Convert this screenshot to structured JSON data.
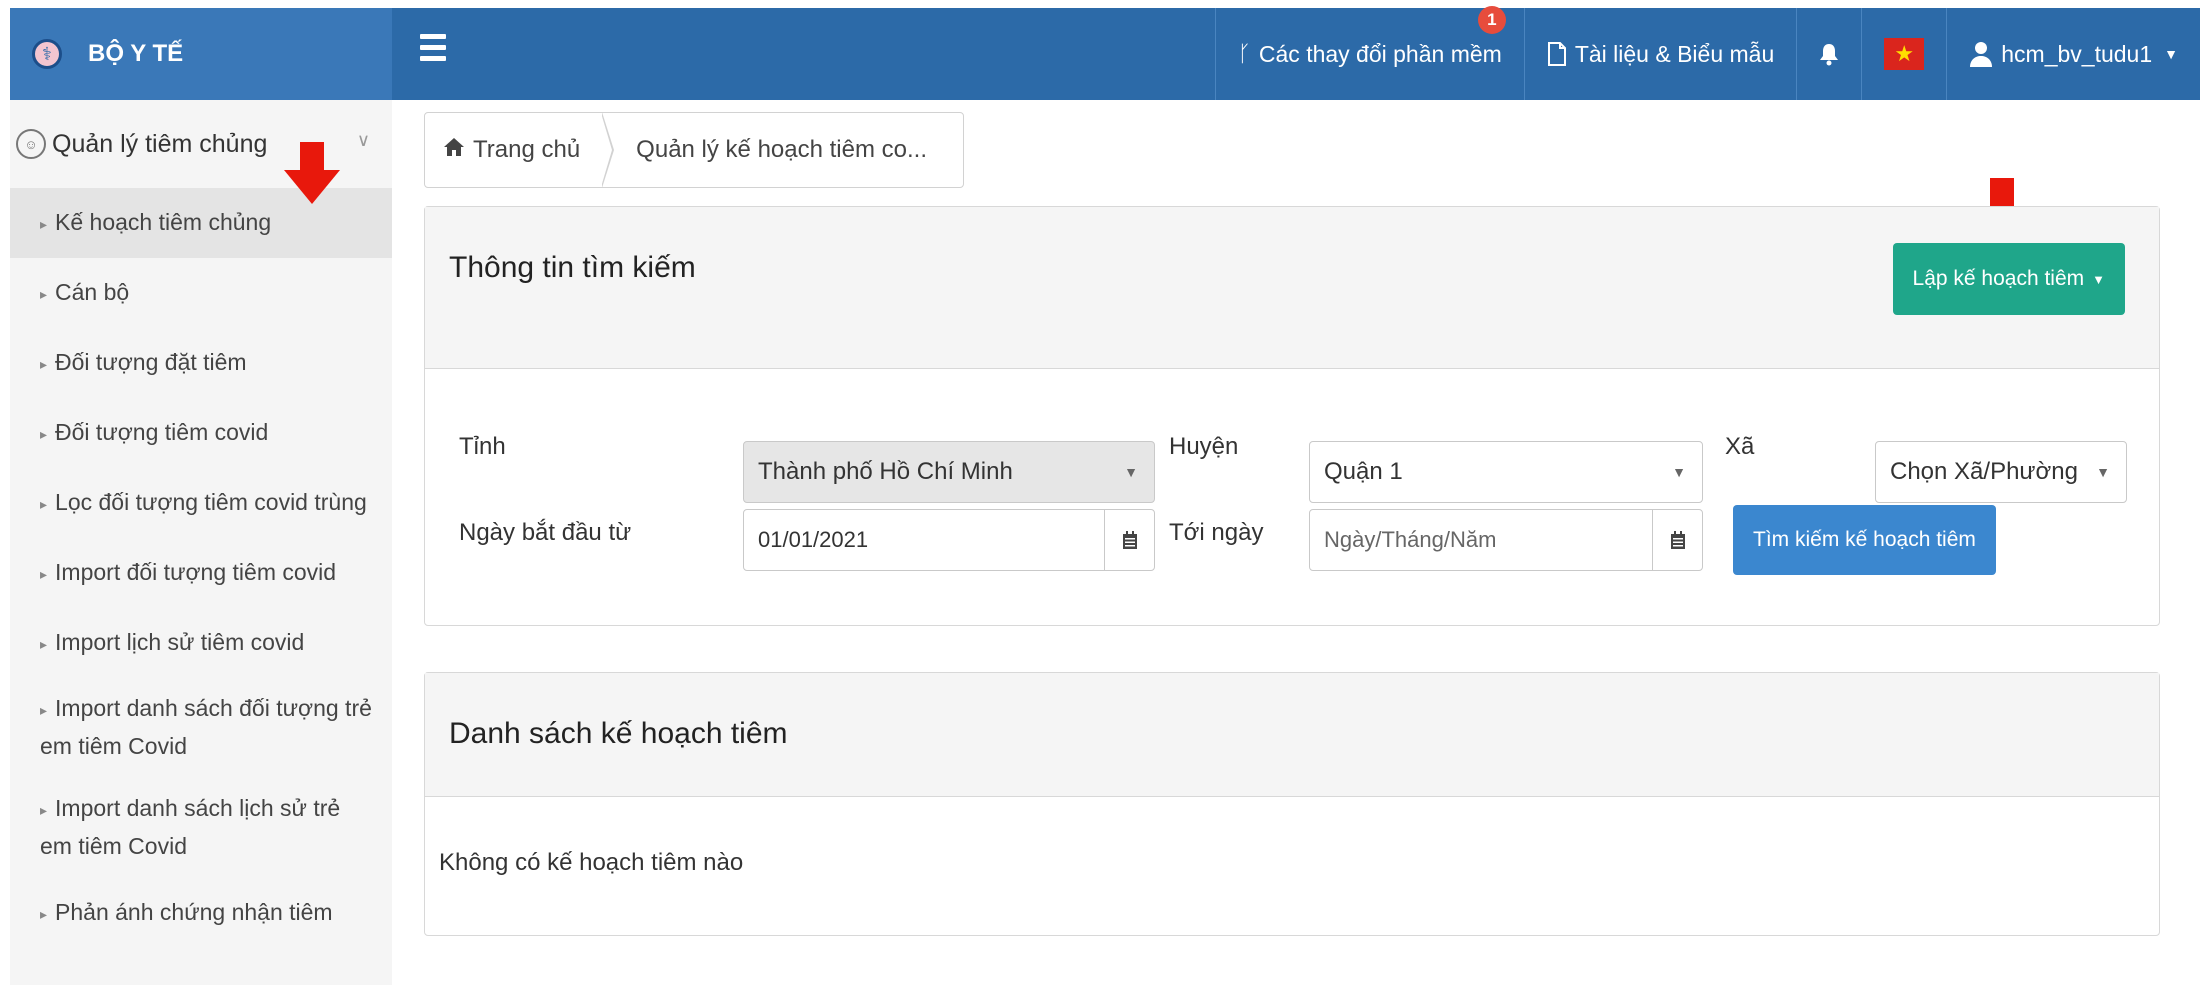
{
  "topbar": {
    "brand": "BỘ Y TẾ",
    "changes_label": "Các thay đổi phần mềm",
    "changes_badge": "1",
    "docs_label": "Tài liệu & Biểu mẫu",
    "username": "hcm_bv_tudu1"
  },
  "sidebar": {
    "section_title": "Quản lý tiêm chủng",
    "items": [
      {
        "label": "Kế hoạch tiêm chủng"
      },
      {
        "label": "Cán bộ"
      },
      {
        "label": "Đối tượng đặt tiêm"
      },
      {
        "label": "Đối tượng tiêm covid"
      },
      {
        "label": "Lọc đối tượng tiêm covid trùng"
      },
      {
        "label": "Import đối tượng tiêm covid"
      },
      {
        "label": "Import lịch sử tiêm covid"
      },
      {
        "label": "Import danh sách đối tượng trẻ em tiêm Covid"
      },
      {
        "label": "Import danh sách lịch sử trẻ em tiêm Covid"
      },
      {
        "label": "Phản ánh chứng nhận tiêm"
      }
    ]
  },
  "breadcrumb": {
    "home": "Trang chủ",
    "current": "Quản lý kế hoạch tiêm co..."
  },
  "search": {
    "title": "Thông tin tìm kiếm",
    "create_button": "Lập kế hoạch tiêm",
    "province_label": "Tỉnh",
    "province_value": "Thành phố Hồ Chí Minh",
    "district_label": "Huyện",
    "district_value": "Quận 1",
    "ward_label": "Xã",
    "ward_value": "Chọn Xã/Phường",
    "start_label": "Ngày bắt đầu từ",
    "start_value": "01/01/2021",
    "end_label": "Tới ngày",
    "end_placeholder": "Ngày/Tháng/Năm",
    "search_button": "Tìm kiếm kế hoạch tiêm"
  },
  "list": {
    "title": "Danh sách kế hoạch tiêm",
    "empty": "Không có kế hoạch tiêm nào"
  },
  "colors": {
    "topbar": "#2c6aa8",
    "brand_bg": "#3a78b8",
    "create_button": "#1fa68a",
    "search_button": "#3b87cf",
    "annotation_arrow": "#e8180c"
  }
}
